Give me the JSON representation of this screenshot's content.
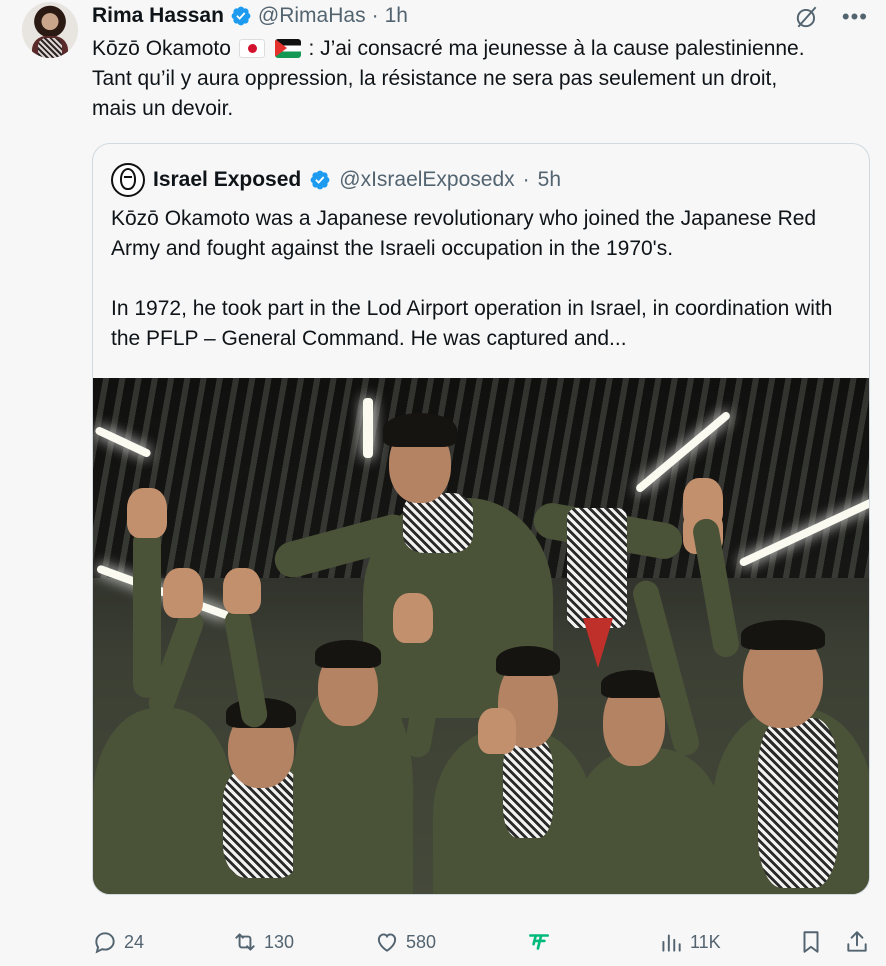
{
  "author": {
    "name": "Rima Hassan",
    "handle": "@RimaHas",
    "time": "1h",
    "dot": "·"
  },
  "tweet": {
    "line_prefix": "Kōzō Okamoto",
    "line_rest": ": J’ai consacré ma jeunesse à la cause palestinienne.",
    "line_2": "Tant qu’il y aura oppression, la résistance ne sera pas seulement un droit,",
    "line_3": "mais un devoir.",
    "flags": [
      "japan-flag-icon",
      "palestine-flag-icon"
    ]
  },
  "quote": {
    "name": "Israel Exposed",
    "handle": "@xIsraelExposedx",
    "dot": "·",
    "time": "5h",
    "paragraph_1": "Kōzō Okamoto was a Japanese revolutionary who joined the Japanese Red Army and fought against the Israeli occupation in the 1970's.",
    "paragraph_2": "In 1972, he took part in the Lod Airport operation in Israel, in coordination with the PFLP – General Command. He was captured and..."
  },
  "actions": {
    "replies": "24",
    "reposts": "130",
    "likes": "580",
    "views": "11K"
  },
  "colors": {
    "background": "#f7f7f7",
    "verified": "#1d9bf0",
    "secondary_text": "#536471",
    "grok_green": "#00ba7c"
  },
  "icons": [
    "verified-icon",
    "grok-icon",
    "more-icon",
    "reply-icon",
    "repost-icon",
    "like-icon",
    "grok-analyze-icon",
    "views-icon",
    "bookmark-icon",
    "share-icon"
  ]
}
